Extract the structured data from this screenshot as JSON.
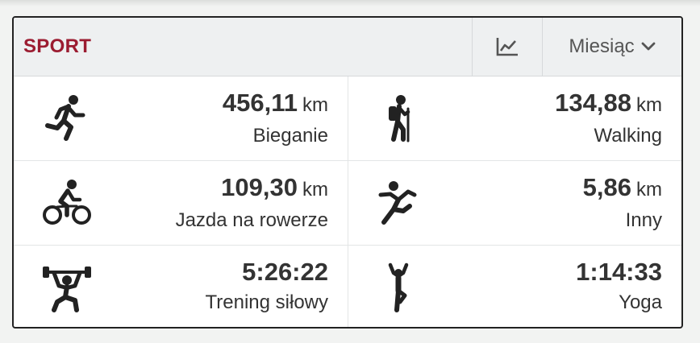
{
  "header": {
    "title": "SPORT",
    "period": "Miesiąc"
  },
  "icons": {
    "chart": "line-chart-icon",
    "dropdown": "chevron-down-icon"
  },
  "activities": [
    {
      "icon": "running-icon",
      "value": "456,11",
      "unit": "km",
      "label": "Bieganie"
    },
    {
      "icon": "hiking-icon",
      "value": "134,88",
      "unit": "km",
      "label": "Walking"
    },
    {
      "icon": "cycling-icon",
      "value": "109,30",
      "unit": "km",
      "label": "Jazda na rowerze"
    },
    {
      "icon": "other-activity-icon",
      "value": "5,86",
      "unit": "km",
      "label": "Inny"
    },
    {
      "icon": "weightlifting-icon",
      "value": "5:26:22",
      "unit": "",
      "label": "Trening siłowy"
    },
    {
      "icon": "yoga-icon",
      "value": "1:14:33",
      "unit": "",
      "label": "Yoga"
    }
  ],
  "colors": {
    "title": "#9b1c31",
    "header_bg": "#eef0f1",
    "text": "#333333"
  }
}
